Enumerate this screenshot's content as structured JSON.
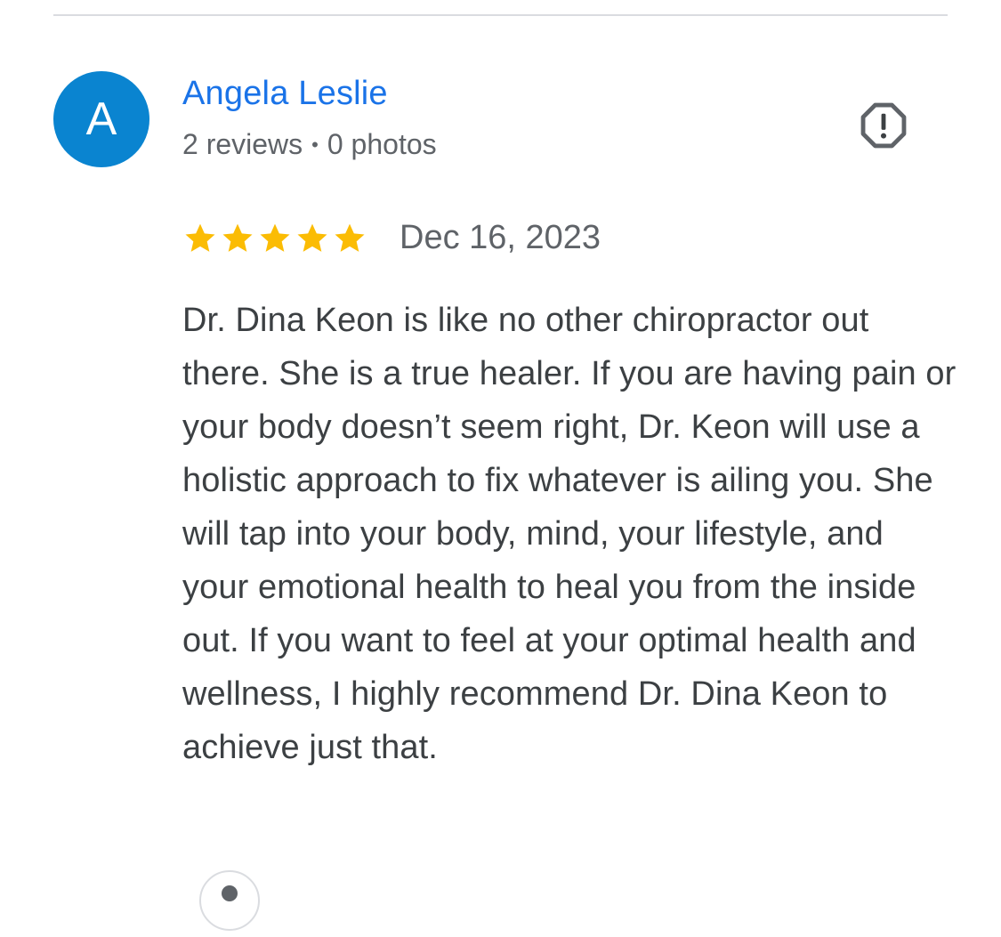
{
  "review": {
    "author": {
      "initial": "A",
      "name": "Angela Leslie",
      "reviews_count": "2 reviews",
      "separator": "•",
      "photos_count": "0 photos",
      "avatar_color": "#0a84d0"
    },
    "rating": {
      "stars": 5,
      "max": 5,
      "star_color": "#fbbc04"
    },
    "date": "Dec 16, 2023",
    "text": "Dr. Dina Keon is like no other chiropractor out there. She is a true healer. If you are having pain or your body doesn’t seem right, Dr. Keon will use a holistic approach to fix whatever is ailing you. She will tap into your body, mind, your lifestyle, and your emotional health to heal you from the inside out. If you want to feel at your optimal health and wellness, I highly recommend Dr. Dina Keon to achieve just that."
  },
  "icons": {
    "report": "report-flag-icon",
    "bottom": "owner-avatar-icon"
  },
  "colors": {
    "name_link": "#1a73e8",
    "meta_text": "#5f6368",
    "body_text": "#3c4043",
    "divider": "#dadce0"
  }
}
